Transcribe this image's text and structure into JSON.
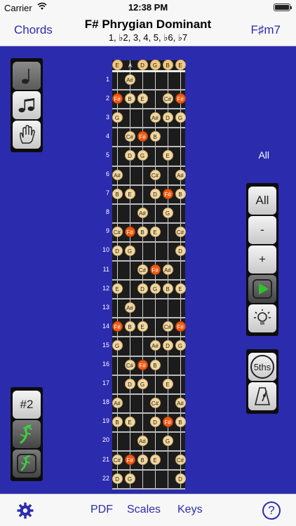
{
  "status": {
    "carrier": "Carrier",
    "time": "12:38 PM"
  },
  "nav": {
    "left": "Chords",
    "title": "F# Phrygian Dominant",
    "subtitle": "1, ♭2, 3, 4, 5, ♭6, ♭7",
    "right": "F♯m7"
  },
  "left_tools": {
    "group_b_label": "#2"
  },
  "right_panel": {
    "all_label": "All",
    "all_button": "All",
    "minus_button": "-",
    "plus_button": "+",
    "fifths_button": "5ths"
  },
  "open_strings": [
    "E",
    "A",
    "D",
    "G",
    "B",
    "E"
  ],
  "frets": [
    "1",
    "2",
    "3",
    "4",
    "5",
    "6",
    "7",
    "8",
    "9",
    "10",
    "11",
    "12",
    "13",
    "14",
    "15",
    "16",
    "17",
    "18",
    "19",
    "20",
    "21",
    "22"
  ],
  "fret_notes": [
    {
      "fret": 0,
      "string": 0,
      "note": "E",
      "kind": "open"
    },
    {
      "fret": 0,
      "string": 2,
      "note": "D",
      "kind": "open"
    },
    {
      "fret": 0,
      "string": 3,
      "note": "G",
      "kind": "open"
    },
    {
      "fret": 0,
      "string": 4,
      "note": "B",
      "kind": "open"
    },
    {
      "fret": 0,
      "string": 5,
      "note": "E",
      "kind": "open"
    },
    {
      "fret": 1,
      "string": 1,
      "note": "A#",
      "kind": "note"
    },
    {
      "fret": 2,
      "string": 0,
      "note": "F#",
      "kind": "root"
    },
    {
      "fret": 2,
      "string": 1,
      "note": "B",
      "kind": "note"
    },
    {
      "fret": 2,
      "string": 2,
      "note": "E",
      "kind": "note"
    },
    {
      "fret": 2,
      "string": 4,
      "note": "C#",
      "kind": "note"
    },
    {
      "fret": 2,
      "string": 5,
      "note": "F#",
      "kind": "root"
    },
    {
      "fret": 3,
      "string": 0,
      "note": "G",
      "kind": "note"
    },
    {
      "fret": 3,
      "string": 3,
      "note": "A#",
      "kind": "note"
    },
    {
      "fret": 3,
      "string": 4,
      "note": "D",
      "kind": "note"
    },
    {
      "fret": 3,
      "string": 5,
      "note": "G",
      "kind": "note"
    },
    {
      "fret": 4,
      "string": 1,
      "note": "C#",
      "kind": "note"
    },
    {
      "fret": 4,
      "string": 2,
      "note": "F#",
      "kind": "root"
    },
    {
      "fret": 4,
      "string": 3,
      "note": "B",
      "kind": "note"
    },
    {
      "fret": 5,
      "string": 1,
      "note": "D",
      "kind": "note"
    },
    {
      "fret": 5,
      "string": 2,
      "note": "G",
      "kind": "note"
    },
    {
      "fret": 5,
      "string": 4,
      "note": "E",
      "kind": "note"
    },
    {
      "fret": 6,
      "string": 0,
      "note": "A#",
      "kind": "note"
    },
    {
      "fret": 6,
      "string": 3,
      "note": "C#",
      "kind": "note"
    },
    {
      "fret": 6,
      "string": 5,
      "note": "A#",
      "kind": "note"
    },
    {
      "fret": 7,
      "string": 0,
      "note": "B",
      "kind": "note"
    },
    {
      "fret": 7,
      "string": 1,
      "note": "E",
      "kind": "note"
    },
    {
      "fret": 7,
      "string": 3,
      "note": "D",
      "kind": "note"
    },
    {
      "fret": 7,
      "string": 4,
      "note": "F#",
      "kind": "root"
    },
    {
      "fret": 7,
      "string": 5,
      "note": "B",
      "kind": "note"
    },
    {
      "fret": 8,
      "string": 2,
      "note": "A#",
      "kind": "note"
    },
    {
      "fret": 8,
      "string": 4,
      "note": "G",
      "kind": "note"
    },
    {
      "fret": 9,
      "string": 0,
      "note": "C#",
      "kind": "note"
    },
    {
      "fret": 9,
      "string": 1,
      "note": "F#",
      "kind": "root"
    },
    {
      "fret": 9,
      "string": 2,
      "note": "B",
      "kind": "note"
    },
    {
      "fret": 9,
      "string": 3,
      "note": "E",
      "kind": "note"
    },
    {
      "fret": 9,
      "string": 5,
      "note": "C#",
      "kind": "note"
    },
    {
      "fret": 10,
      "string": 0,
      "note": "D",
      "kind": "note"
    },
    {
      "fret": 10,
      "string": 1,
      "note": "G",
      "kind": "note"
    },
    {
      "fret": 10,
      "string": 5,
      "note": "D",
      "kind": "note"
    },
    {
      "fret": 11,
      "string": 2,
      "note": "C#",
      "kind": "note"
    },
    {
      "fret": 11,
      "string": 3,
      "note": "F#",
      "kind": "root"
    },
    {
      "fret": 11,
      "string": 4,
      "note": "A#",
      "kind": "note"
    },
    {
      "fret": 12,
      "string": 0,
      "note": "E",
      "kind": "note"
    },
    {
      "fret": 12,
      "string": 2,
      "note": "D",
      "kind": "note"
    },
    {
      "fret": 12,
      "string": 3,
      "note": "G",
      "kind": "note"
    },
    {
      "fret": 12,
      "string": 4,
      "note": "B",
      "kind": "note"
    },
    {
      "fret": 12,
      "string": 5,
      "note": "E",
      "kind": "note"
    },
    {
      "fret": 13,
      "string": 1,
      "note": "A#",
      "kind": "note"
    },
    {
      "fret": 14,
      "string": 0,
      "note": "F#",
      "kind": "root"
    },
    {
      "fret": 14,
      "string": 1,
      "note": "B",
      "kind": "note"
    },
    {
      "fret": 14,
      "string": 2,
      "note": "E",
      "kind": "note"
    },
    {
      "fret": 14,
      "string": 4,
      "note": "C#",
      "kind": "note"
    },
    {
      "fret": 14,
      "string": 5,
      "note": "F#",
      "kind": "root"
    },
    {
      "fret": 15,
      "string": 0,
      "note": "G",
      "kind": "note"
    },
    {
      "fret": 15,
      "string": 3,
      "note": "A#",
      "kind": "note"
    },
    {
      "fret": 15,
      "string": 4,
      "note": "D",
      "kind": "note"
    },
    {
      "fret": 15,
      "string": 5,
      "note": "G",
      "kind": "note"
    },
    {
      "fret": 16,
      "string": 1,
      "note": "C#",
      "kind": "note"
    },
    {
      "fret": 16,
      "string": 2,
      "note": "F#",
      "kind": "root"
    },
    {
      "fret": 16,
      "string": 3,
      "note": "B",
      "kind": "note"
    },
    {
      "fret": 17,
      "string": 1,
      "note": "D",
      "kind": "note"
    },
    {
      "fret": 17,
      "string": 2,
      "note": "G",
      "kind": "note"
    },
    {
      "fret": 17,
      "string": 4,
      "note": "E",
      "kind": "note"
    },
    {
      "fret": 18,
      "string": 0,
      "note": "A#",
      "kind": "note"
    },
    {
      "fret": 18,
      "string": 3,
      "note": "C#",
      "kind": "note"
    },
    {
      "fret": 18,
      "string": 5,
      "note": "A#",
      "kind": "note"
    },
    {
      "fret": 19,
      "string": 0,
      "note": "B",
      "kind": "note"
    },
    {
      "fret": 19,
      "string": 1,
      "note": "E",
      "kind": "note"
    },
    {
      "fret": 19,
      "string": 3,
      "note": "D",
      "kind": "note"
    },
    {
      "fret": 19,
      "string": 4,
      "note": "F#",
      "kind": "root"
    },
    {
      "fret": 19,
      "string": 5,
      "note": "B",
      "kind": "note"
    },
    {
      "fret": 20,
      "string": 2,
      "note": "A#",
      "kind": "note"
    },
    {
      "fret": 20,
      "string": 4,
      "note": "G",
      "kind": "note"
    },
    {
      "fret": 21,
      "string": 0,
      "note": "C#",
      "kind": "note"
    },
    {
      "fret": 21,
      "string": 1,
      "note": "F#",
      "kind": "root"
    },
    {
      "fret": 21,
      "string": 2,
      "note": "B",
      "kind": "note"
    },
    {
      "fret": 21,
      "string": 3,
      "note": "E",
      "kind": "note"
    },
    {
      "fret": 21,
      "string": 5,
      "note": "C#",
      "kind": "note"
    },
    {
      "fret": 22,
      "string": 0,
      "note": "D",
      "kind": "note"
    },
    {
      "fret": 22,
      "string": 1,
      "note": "G",
      "kind": "note"
    },
    {
      "fret": 22,
      "string": 5,
      "note": "D",
      "kind": "note"
    }
  ],
  "tabs": {
    "pdf": "PDF",
    "scales": "Scales",
    "keys": "Keys",
    "help": "?"
  },
  "icons": {
    "note_single": "eighth-note-icon",
    "note_double": "beamed-notes-icon",
    "hand": "hand-icon",
    "lizard_a": "lizard-icon",
    "lizard_b": "lizard-loop-icon",
    "play": "play-loop-icon",
    "bulb": "lightbulb-icon",
    "metronome": "metronome-icon",
    "gear": "gear-icon",
    "wifi": "wifi-icon",
    "battery": "battery-icon"
  },
  "colors": {
    "background": "#2b2bae",
    "accent": "#2b2bb0",
    "root_note": "#f05a12",
    "note": "#f2d8a0"
  }
}
